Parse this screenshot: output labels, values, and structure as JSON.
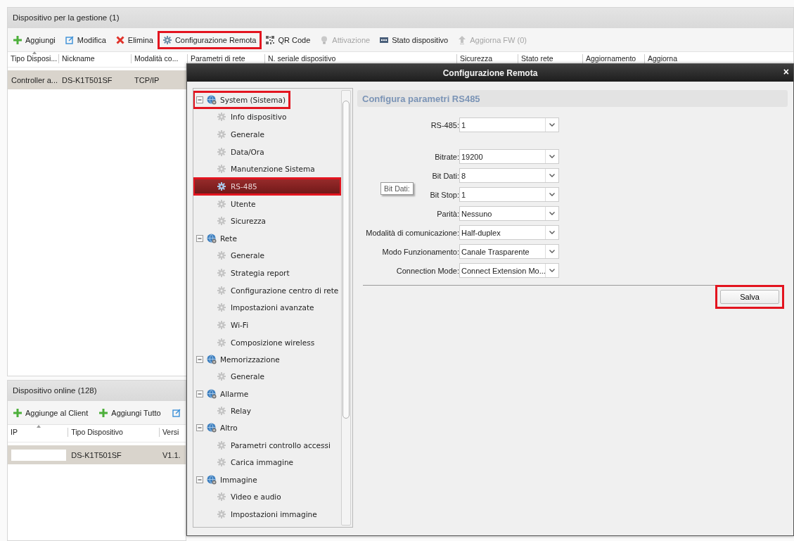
{
  "main_panel": {
    "title": "Dispositivo per la gestione (1)",
    "toolbar": [
      {
        "label": "Aggiungi",
        "kind": "plus",
        "disabled": false,
        "highlighted": false
      },
      {
        "label": "Modifica",
        "kind": "edit",
        "disabled": false,
        "highlighted": false
      },
      {
        "label": "Elimina",
        "kind": "delete",
        "disabled": false,
        "highlighted": false
      },
      {
        "label": "Configurazione Remota",
        "kind": "gear",
        "disabled": false,
        "highlighted": true
      },
      {
        "label": "QR Code",
        "kind": "qr",
        "disabled": false,
        "highlighted": false
      },
      {
        "label": "Attivazione",
        "kind": "bulb",
        "disabled": true,
        "highlighted": false
      },
      {
        "label": "Stato dispositivo",
        "kind": "card",
        "disabled": false,
        "highlighted": false
      },
      {
        "label": "Aggiorna FW (0)",
        "kind": "upload",
        "disabled": true,
        "highlighted": false
      }
    ],
    "columns": [
      {
        "label": "Tipo Disposi...",
        "sorted": true
      },
      {
        "label": "Nickname",
        "sorted": false
      },
      {
        "label": "Modalità co...",
        "sorted": false
      },
      {
        "label": "Parametri di rete",
        "sorted": false
      },
      {
        "label": "N. seriale dispositivo",
        "sorted": false
      },
      {
        "label": "Sicurezza",
        "sorted": false
      },
      {
        "label": "Stato rete",
        "sorted": false
      },
      {
        "label": "Aggiornamento",
        "sorted": false
      },
      {
        "label": "Aggiorna",
        "sorted": false
      }
    ],
    "rows": [
      {
        "selected": true,
        "cells": [
          "Controller a...",
          "DS-K1T501SF",
          "TCP/IP"
        ]
      }
    ]
  },
  "online_panel": {
    "title": "Dispositivo online (128)",
    "toolbar": [
      {
        "label": "Aggiunge al Client",
        "kind": "plus"
      },
      {
        "label": "Aggiungi Tutto",
        "kind": "plus"
      },
      {
        "kind": "edit"
      }
    ],
    "columns": [
      {
        "label": "IP",
        "sorted": true
      },
      {
        "label": "Tipo Dispositivo",
        "sorted": false
      },
      {
        "label": "Versi",
        "sorted": false
      }
    ],
    "rows": [
      {
        "selected": true,
        "cells": [
          "",
          "DS-K1T501SF",
          "V1.1."
        ]
      }
    ]
  },
  "dialog": {
    "title": "Configurazione Remota",
    "close": "×",
    "tree": [
      {
        "label": "System (Sistema)",
        "expanded": true,
        "highlighted": true,
        "children": [
          {
            "label": "Info dispositivo",
            "selected": false,
            "highlighted": false
          },
          {
            "label": "Generale",
            "selected": false,
            "highlighted": false
          },
          {
            "label": "Data/Ora",
            "selected": false,
            "highlighted": false
          },
          {
            "label": "Manutenzione Sistema",
            "selected": false,
            "highlighted": false
          },
          {
            "label": "RS-485",
            "selected": true,
            "highlighted": true
          },
          {
            "label": "Utente",
            "selected": false,
            "highlighted": false
          },
          {
            "label": "Sicurezza",
            "selected": false,
            "highlighted": false
          }
        ]
      },
      {
        "label": "Rete",
        "expanded": true,
        "highlighted": false,
        "children": [
          {
            "label": "Generale",
            "selected": false,
            "highlighted": false
          },
          {
            "label": "Strategia report",
            "selected": false,
            "highlighted": false
          },
          {
            "label": "Configurazione centro di rete",
            "selected": false,
            "highlighted": false
          },
          {
            "label": "Impostazioni avanzate",
            "selected": false,
            "highlighted": false
          },
          {
            "label": "Wi-Fi",
            "selected": false,
            "highlighted": false
          },
          {
            "label": "Composizione wireless",
            "selected": false,
            "highlighted": false
          }
        ]
      },
      {
        "label": "Memorizzazione",
        "expanded": true,
        "highlighted": false,
        "children": [
          {
            "label": "Generale",
            "selected": false,
            "highlighted": false
          }
        ]
      },
      {
        "label": "Allarme",
        "expanded": true,
        "highlighted": false,
        "children": [
          {
            "label": "Relay",
            "selected": false,
            "highlighted": false
          }
        ]
      },
      {
        "label": "Altro",
        "expanded": true,
        "highlighted": false,
        "children": [
          {
            "label": "Parametri controllo accessi",
            "selected": false,
            "highlighted": false
          },
          {
            "label": "Carica immagine",
            "selected": false,
            "highlighted": false
          }
        ]
      },
      {
        "label": "Immagine",
        "expanded": true,
        "highlighted": false,
        "children": [
          {
            "label": "Video e audio",
            "selected": false,
            "highlighted": false
          },
          {
            "label": "Impostazioni immagine",
            "selected": false,
            "highlighted": false
          }
        ]
      }
    ],
    "section_title": "Configura parametri RS485",
    "fields": [
      {
        "label": "RS-485:",
        "value": "1"
      },
      {
        "label": "Bitrate:",
        "value": "19200"
      },
      {
        "label": "Bit Dati:",
        "value": "8"
      },
      {
        "label": "Bit Stop:",
        "value": "1"
      },
      {
        "label": "Parità:",
        "value": "Nessuno"
      },
      {
        "label": "Modalità di comunicazione:",
        "value": "Half-duplex"
      },
      {
        "label": "Modo Funzionamento:",
        "value": "Canale Trasparente"
      },
      {
        "label": "Connection Mode:",
        "value": "Connect Extension Mo..."
      }
    ],
    "tooltip": "Bit Dati:",
    "save_button": {
      "label": "Salva",
      "highlighted": true
    }
  }
}
